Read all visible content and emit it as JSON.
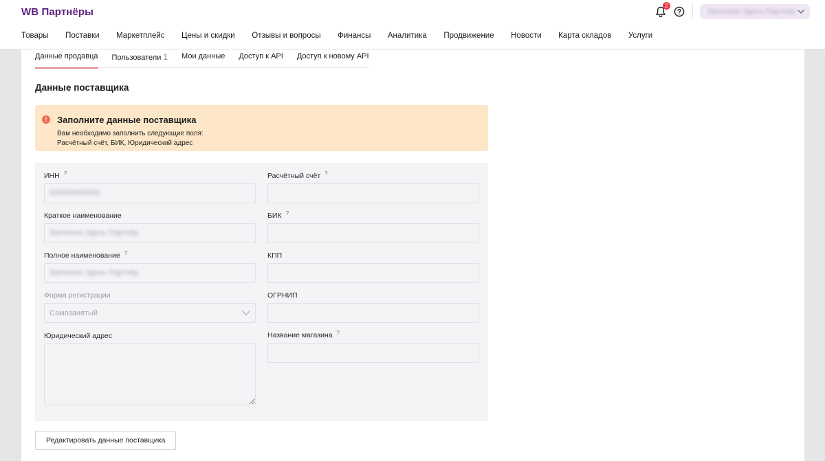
{
  "header": {
    "logo": "WB Партнёры",
    "notifications": {
      "count": "2",
      "icon": "bell-icon"
    },
    "help_icon": "help-circle-icon",
    "account": {
      "name": "Заполнен Здесь Партнёр",
      "icon": "chevron-down-icon"
    }
  },
  "nav": {
    "items": [
      {
        "label": "Товары"
      },
      {
        "label": "Поставки"
      },
      {
        "label": "Маркетплейс"
      },
      {
        "label": "Цены и скидки"
      },
      {
        "label": "Отзывы и вопросы"
      },
      {
        "label": "Финансы"
      },
      {
        "label": "Аналитика"
      },
      {
        "label": "Продвижение"
      },
      {
        "label": "Новости"
      },
      {
        "label": "Карта складов"
      },
      {
        "label": "Услуги"
      }
    ]
  },
  "tabs": {
    "items": [
      {
        "label": "Данные продавца",
        "active": true
      },
      {
        "label": "Пользователи",
        "count": "1"
      },
      {
        "label": "Мои данные"
      },
      {
        "label": "Доступ к API"
      },
      {
        "label": "Доступ к новому API"
      }
    ]
  },
  "main": {
    "title": "Данные поставщика",
    "alert": {
      "icon": "exclamation-icon",
      "title": "Заполните данные поставщика",
      "line1": "Вам необходимо заполнить следующие поля:",
      "line2": "Расчётный счёт, БИК, Юридический адрес"
    },
    "fields": {
      "inn": {
        "label": "ИНН",
        "hint": "?",
        "value": "000000000000"
      },
      "short_name": {
        "label": "Краткое наименование",
        "value": "Заполнен Здесь Партнёр"
      },
      "full_name": {
        "label": "Полное наименование",
        "hint": "?",
        "value": "Заполнен Здесь Партнёр"
      },
      "reg_form": {
        "label": "Форма регистрации",
        "value": "Самозанятый"
      },
      "legal_address": {
        "label": "Юридический адрес",
        "value": ""
      },
      "account": {
        "label": "Расчётный счёт",
        "hint": "?",
        "value": ""
      },
      "bik": {
        "label": "БИК",
        "hint": "?",
        "value": ""
      },
      "kpp": {
        "label": "КПП",
        "value": ""
      },
      "ogrnip": {
        "label": "ОГРНИП",
        "value": ""
      },
      "store_name": {
        "label": "Название магазина",
        "hint": "?",
        "value": ""
      }
    },
    "edit_button": "Редактировать данные поставщика"
  },
  "colors": {
    "brand": "#5a1f7e",
    "alert_bg": "#fde7c8",
    "alert_icon": "#f2684a",
    "badge": "#f0364a",
    "tab_underline": "#e38b8b"
  }
}
